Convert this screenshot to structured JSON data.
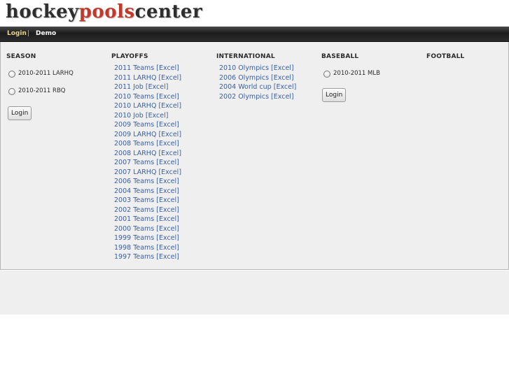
{
  "logo": {
    "part1": "hockey",
    "part2": "pools",
    "part3": "center"
  },
  "nav": {
    "login": "Login",
    "separator": "|",
    "demo": "Demo"
  },
  "season": {
    "title": "SEASON",
    "options": [
      "2010-2011 LARHQ",
      "2010-2011 RBQ"
    ],
    "button": "Login"
  },
  "playoffs": {
    "title": "PLAYOFFS",
    "links": [
      "2011 Teams [Excel]",
      "2011 LARHQ [Excel]",
      "2011 Job [Excel]",
      "2010 Teams [Excel]",
      "2010 LARHQ [Excel]",
      "2010 Job [Excel]",
      "2009 Teams [Excel]",
      "2009 LARHQ [Excel]",
      "2008 Teams [Excel]",
      "2008 LARHQ [Excel]",
      "2007 Teams [Excel]",
      "2007 LARHQ [Excel]",
      "2006 Teams [Excel]",
      "2004 Teams [Excel]",
      "2003 Teams [Excel]",
      "2002 Teams [Excel]",
      "2001 Teams [Excel]",
      "2000 Teams [Excel]",
      "1999 Teams [Excel]",
      "1998 Teams [Excel]",
      "1997 Teams [Excel]"
    ]
  },
  "international": {
    "title": "INTERNATIONAL",
    "links": [
      "2010 Olympics [Excel]",
      "2006 Olympics [Excel]",
      "2004 World cup [Excel]",
      "2002 Olympics [Excel]"
    ]
  },
  "baseball": {
    "title": "BASEBALL",
    "options": [
      "2010-2011 MLB"
    ],
    "button": "Login"
  },
  "football": {
    "title": "FOOTBALL"
  },
  "colors": {
    "link": "#3a5f9f",
    "nav_login": "#e8d88c",
    "panel_bg": "#efefef",
    "logo_accent": "#c0392b"
  }
}
